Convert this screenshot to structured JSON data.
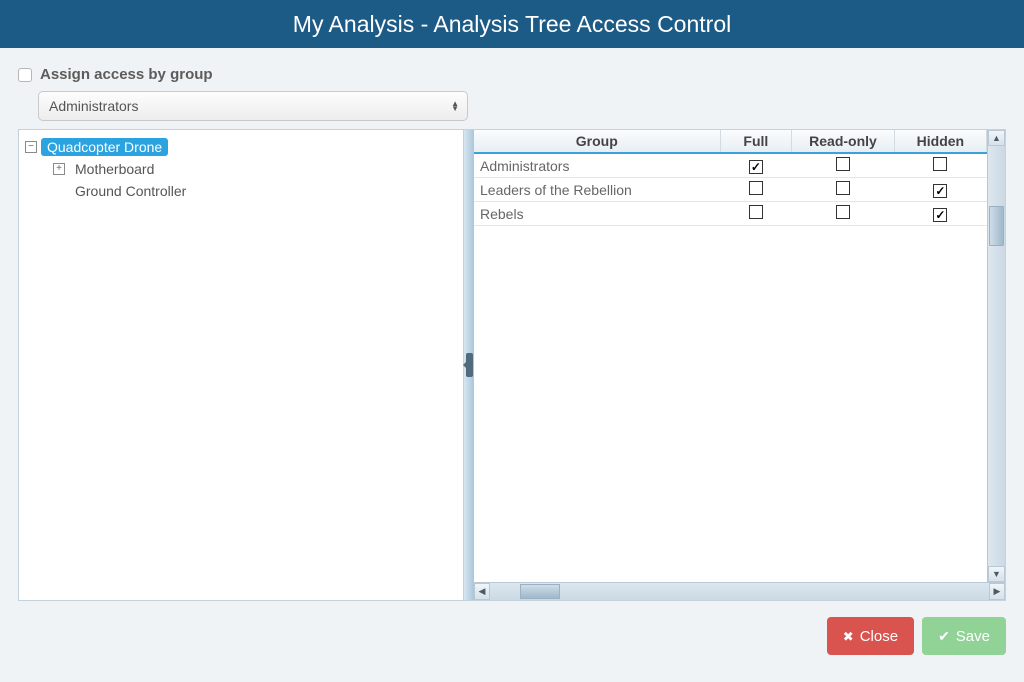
{
  "header": {
    "title": "My Analysis - Analysis Tree Access Control"
  },
  "assign": {
    "checkbox_label": "Assign access by group",
    "checked": false,
    "selected_group": "Administrators"
  },
  "tree": {
    "root": {
      "label": "Quadcopter Drone",
      "selected": true,
      "expanded": true,
      "children": [
        {
          "label": "Motherboard",
          "has_children": true,
          "expanded": false
        },
        {
          "label": "Ground Controller",
          "has_children": false
        }
      ]
    }
  },
  "table": {
    "columns": [
      "Group",
      "Full",
      "Read-only",
      "Hidden"
    ],
    "rows": [
      {
        "group": "Administrators",
        "full": true,
        "readonly": false,
        "hidden": false
      },
      {
        "group": "Leaders of the Rebellion",
        "full": false,
        "readonly": false,
        "hidden": true
      },
      {
        "group": "Rebels",
        "full": false,
        "readonly": false,
        "hidden": true
      }
    ]
  },
  "footer": {
    "close_label": "Close",
    "save_label": "Save"
  }
}
